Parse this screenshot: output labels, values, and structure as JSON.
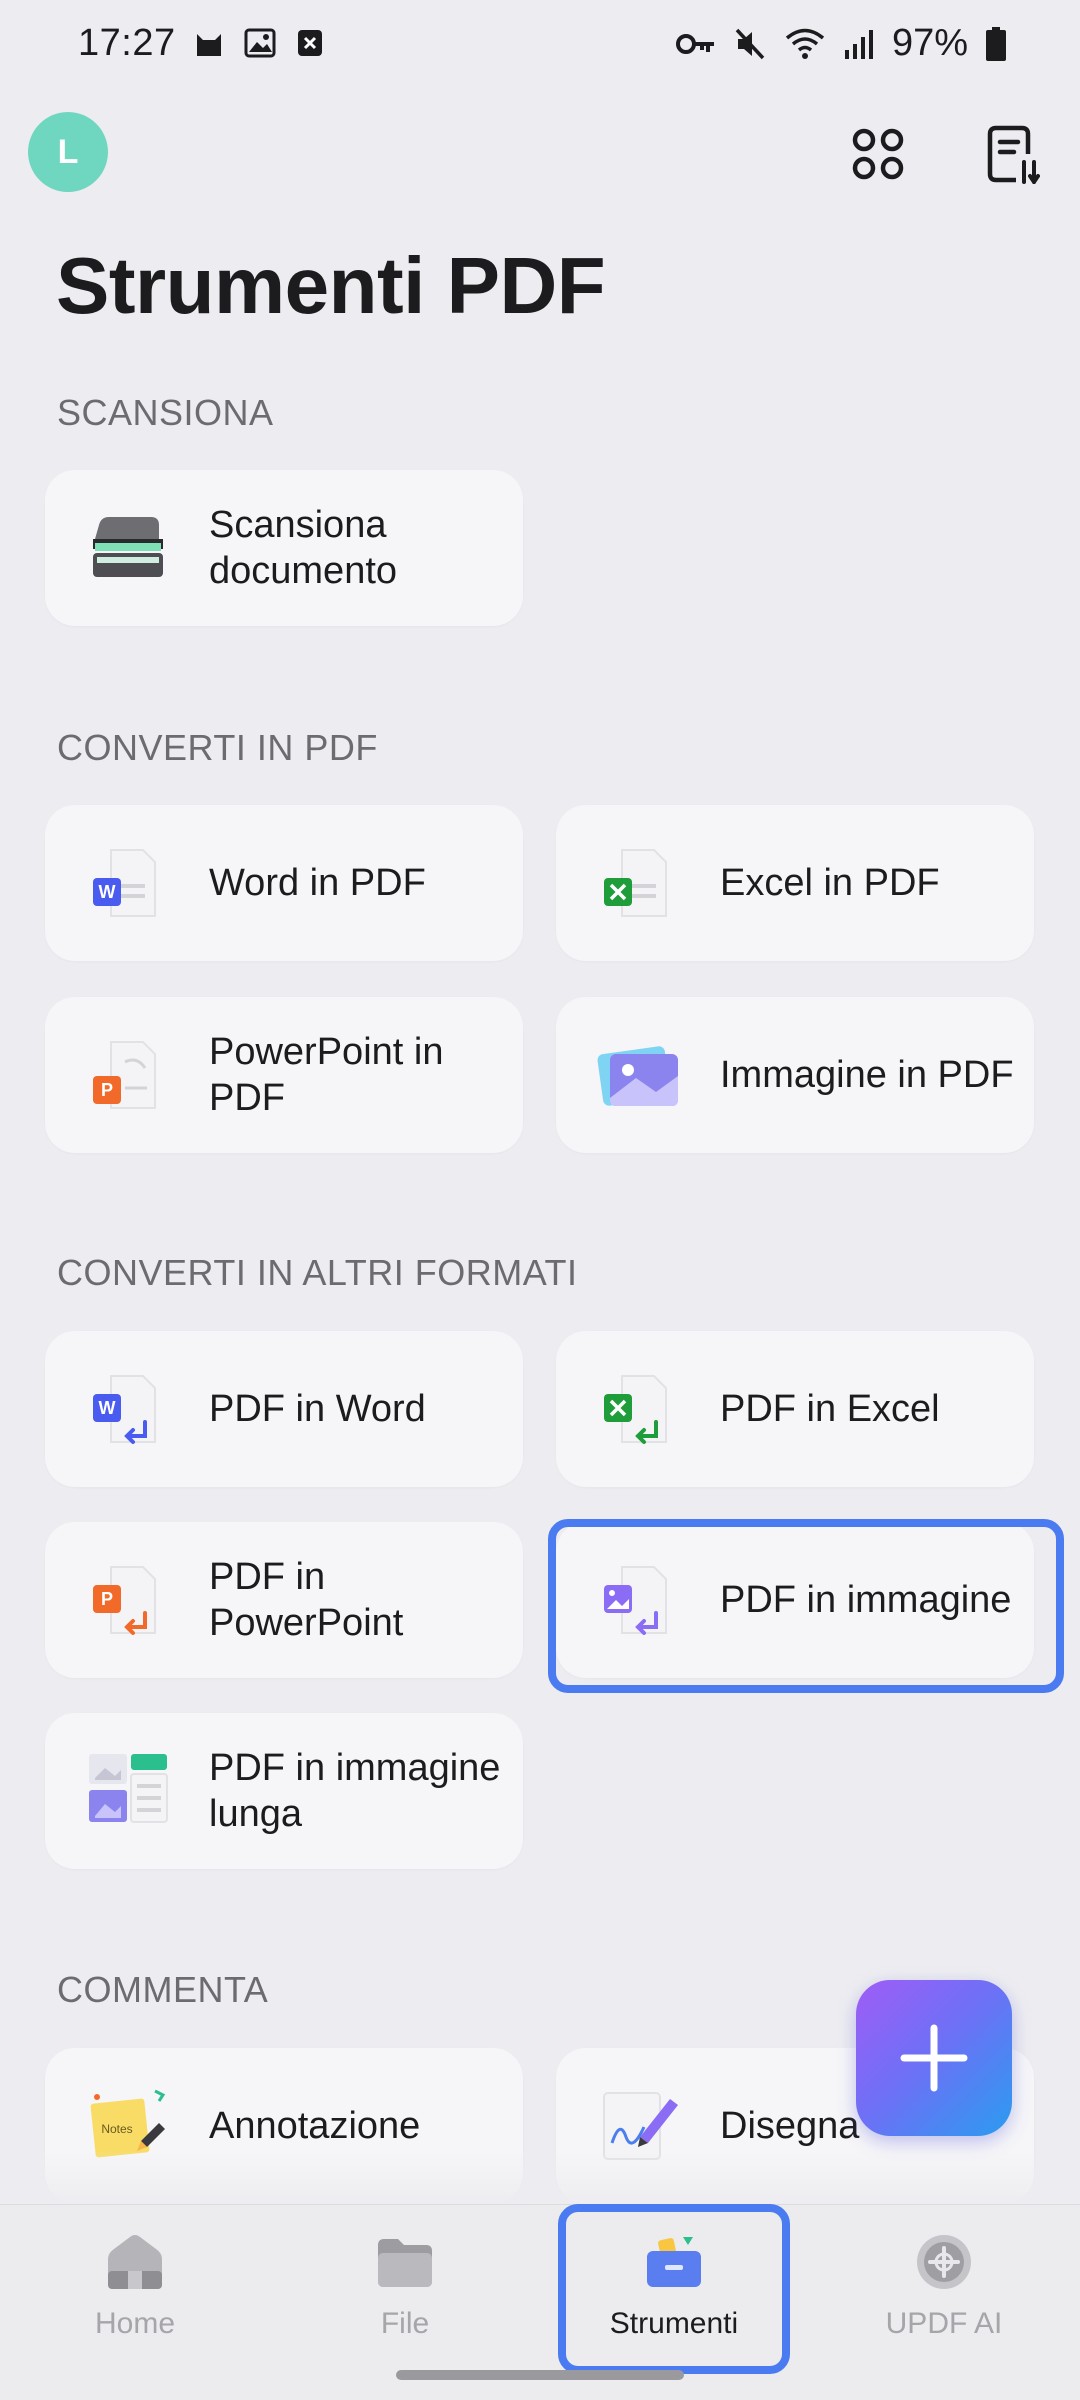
{
  "status_bar": {
    "time": "17:27",
    "battery": "97%",
    "left_icons": [
      "cat-notification-icon",
      "image-notification-icon",
      "close-box-notification-icon"
    ],
    "right_icons": [
      "key-icon",
      "mute-icon",
      "wifi-icon",
      "signal-icon",
      "battery-icon"
    ]
  },
  "header": {
    "avatar_letter": "L",
    "avatar_color": "#6fd6bf",
    "title": "Strumenti PDF"
  },
  "sections": [
    {
      "title": "SCANSIONA",
      "items": [
        {
          "label": "Scansiona documento",
          "icon": "scanner-icon"
        }
      ]
    },
    {
      "title": "CONVERTI IN PDF",
      "items": [
        {
          "label": "Word in PDF",
          "icon": "word-to-pdf-icon"
        },
        {
          "label": "Excel in PDF",
          "icon": "excel-to-pdf-icon"
        },
        {
          "label": "PowerPoint in PDF",
          "icon": "powerpoint-to-pdf-icon"
        },
        {
          "label": "Immagine in PDF",
          "icon": "image-to-pdf-icon"
        }
      ]
    },
    {
      "title": "CONVERTI IN ALTRI FORMATI",
      "items": [
        {
          "label": "PDF in Word",
          "icon": "pdf-to-word-icon"
        },
        {
          "label": "PDF in Excel",
          "icon": "pdf-to-excel-icon"
        },
        {
          "label": "PDF in PowerPoint",
          "icon": "pdf-to-powerpoint-icon"
        },
        {
          "label": "PDF in immagine",
          "icon": "pdf-to-image-icon",
          "highlighted": true
        },
        {
          "label": "PDF in immagine lunga",
          "icon": "pdf-to-long-image-icon"
        }
      ]
    },
    {
      "title": "COMMENTA",
      "items": [
        {
          "label": "Annotazione",
          "icon": "sticky-note-icon"
        },
        {
          "label": "Disegna",
          "icon": "draw-pen-icon"
        }
      ]
    }
  ],
  "fab": {
    "icon": "plus-icon"
  },
  "bottom_nav": [
    {
      "label": "Home",
      "icon": "home-icon",
      "active": false
    },
    {
      "label": "File",
      "icon": "folder-icon",
      "active": false
    },
    {
      "label": "Strumenti",
      "icon": "toolbox-icon",
      "active": true
    },
    {
      "label": "UPDF AI",
      "icon": "ai-icon",
      "active": false
    }
  ],
  "colors": {
    "accent_highlight": "#4b7bf0",
    "word": "#4a5cf0",
    "excel": "#1f9d3a",
    "powerpoint": "#f26a2a",
    "image": "#8a6cf5"
  }
}
